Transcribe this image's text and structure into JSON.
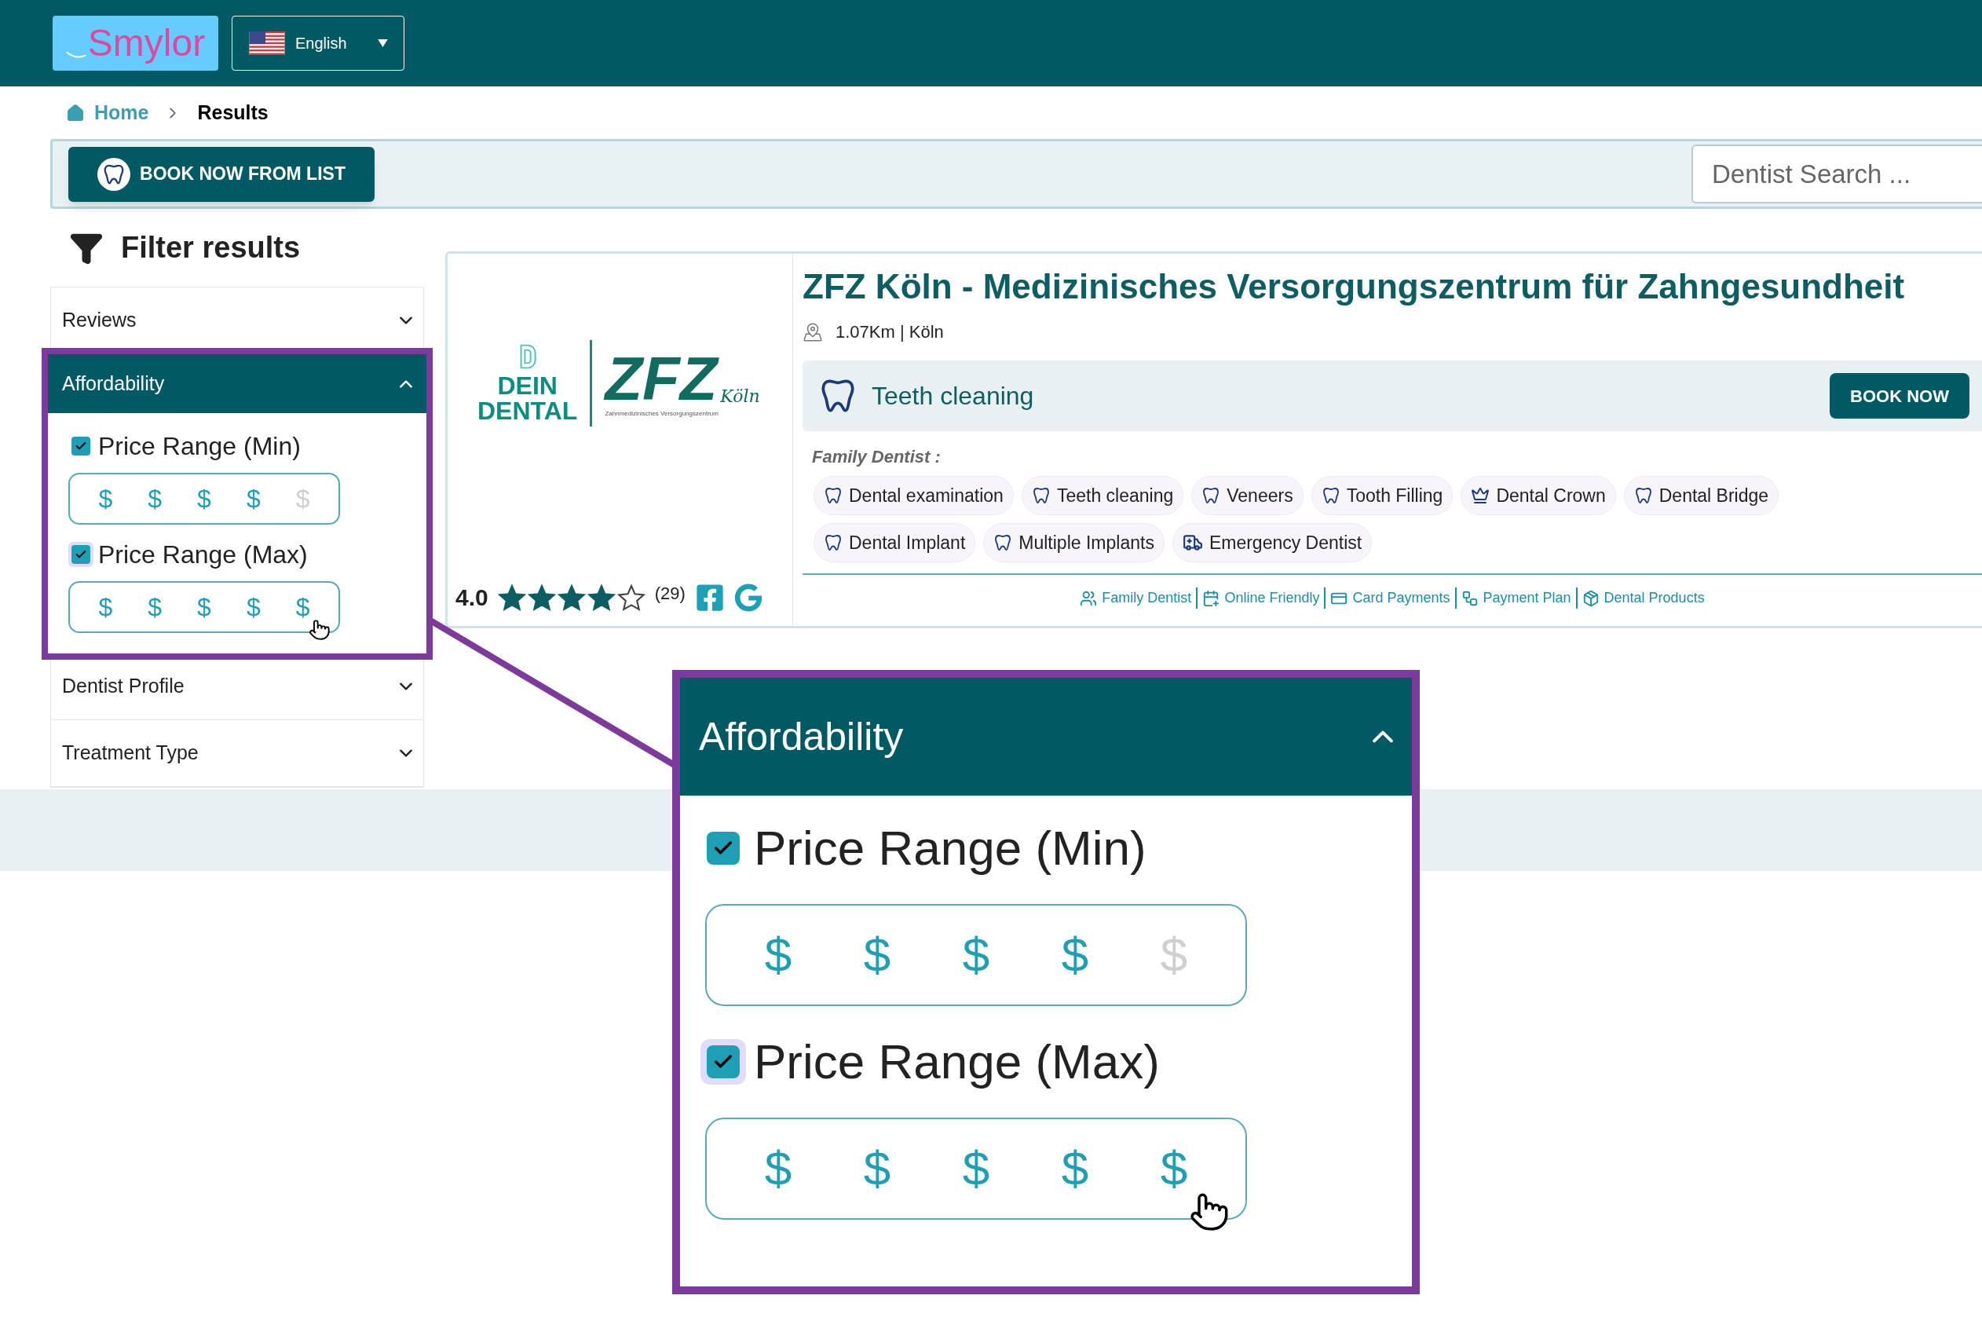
{
  "header": {
    "logo": "Smylor",
    "language": "English"
  },
  "breadcrumb": [
    {
      "label": "Home",
      "kind": "link"
    },
    {
      "label": "Results",
      "kind": "current"
    }
  ],
  "book_list_button": "BOOK NOW FROM LIST",
  "search": {
    "placeholder": "Dentist Search ..."
  },
  "filter": {
    "title": "Filter results",
    "sections": [
      {
        "title": "Reviews",
        "expanded": false,
        "highlighted": false
      },
      {
        "title": "Affordability",
        "expanded": true,
        "highlighted": true,
        "options": [
          {
            "label": "Price Range (Min)",
            "checked": true,
            "focused": false,
            "pointer": false,
            "dollars": [
              {
                "label": "$",
                "active": true
              },
              {
                "label": "$",
                "active": true
              },
              {
                "label": "$",
                "active": true
              },
              {
                "label": "$",
                "active": true
              },
              {
                "label": "$",
                "active": false
              }
            ]
          },
          {
            "label": "Price Range (Max)",
            "checked": true,
            "focused": true,
            "pointer": true,
            "dollars": [
              {
                "label": "$",
                "active": true
              },
              {
                "label": "$",
                "active": true
              },
              {
                "label": "$",
                "active": true
              },
              {
                "label": "$",
                "active": true
              },
              {
                "label": "$",
                "active": true
              }
            ]
          }
        ]
      },
      {
        "title": "Dentist Profile",
        "expanded": false,
        "highlighted": false
      },
      {
        "title": "Treatment Type",
        "expanded": false,
        "highlighted": false
      }
    ]
  },
  "clinic": {
    "logo": {
      "left_top": "DEIN",
      "left_bottom": "DENTAL",
      "brand": "ZFZ",
      "city": "Köln",
      "tagline": "Zahnmedizinisches Versorgungszentrum"
    },
    "rating": "4.0",
    "stars": 4,
    "reviews": "(29)",
    "name": "ZFZ Köln - Medizinisches Versorgungszentrum für Zahngesundheit",
    "distance": "1.07Km | Köln",
    "featured_treatment": "Teeth cleaning",
    "book_button": "BOOK NOW",
    "category": "Family Dentist :",
    "treatments": [
      "Dental examination",
      "Teeth cleaning",
      "Veneers",
      "Tooth Filling",
      "Dental Crown",
      "Dental Bridge",
      "Dental Implant",
      "Multiple Implants",
      "Emergency Dentist"
    ],
    "features": [
      "Family Dentist",
      "Online Friendly",
      "Card Payments",
      "Payment Plan",
      "Dental Products"
    ]
  },
  "callout": {
    "title": "Affordability",
    "expanded": true,
    "options": [
      {
        "label": "Price Range (Min)",
        "checked": true,
        "focused": false,
        "pointer": false,
        "dollars": [
          {
            "label": "$",
            "active": true
          },
          {
            "label": "$",
            "active": true
          },
          {
            "label": "$",
            "active": true
          },
          {
            "label": "$",
            "active": true
          },
          {
            "label": "$",
            "active": false
          }
        ]
      },
      {
        "label": "Price Range (Max)",
        "checked": true,
        "focused": true,
        "pointer": true,
        "dollars": [
          {
            "label": "$",
            "active": true
          },
          {
            "label": "$",
            "active": true
          },
          {
            "label": "$",
            "active": true
          },
          {
            "label": "$",
            "active": true
          },
          {
            "label": "$",
            "active": true
          }
        ]
      }
    ]
  }
}
